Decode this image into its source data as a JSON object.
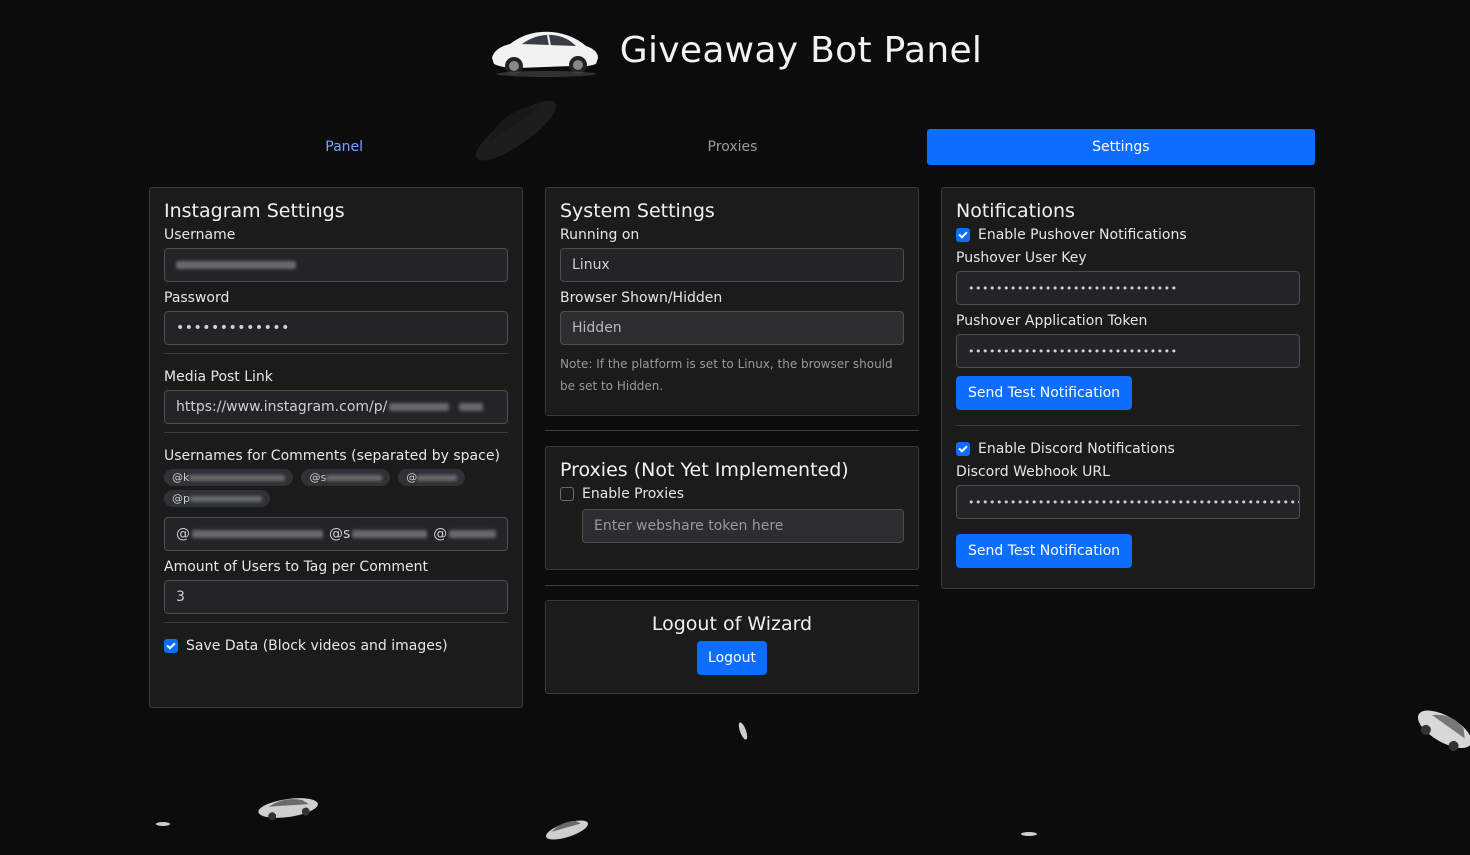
{
  "app": {
    "title": "Giveaway Bot Panel"
  },
  "tabs": [
    {
      "label": "Panel",
      "state": "link"
    },
    {
      "label": "Proxies",
      "state": "inactive"
    },
    {
      "label": "Settings",
      "state": "active"
    }
  ],
  "instagram": {
    "heading": "Instagram Settings",
    "username_label": "Username",
    "password_label": "Password",
    "password_value": "•••••••••••••",
    "media_label": "Media Post Link",
    "media_value": "https://www.instagram.com/p/",
    "comments_label": "Usernames for Comments (separated by space)",
    "chips": [
      "@k",
      "@s",
      "@",
      "@p"
    ],
    "comments_field_prefixes": [
      "@",
      "@s",
      "@"
    ],
    "amount_label": "Amount of Users to Tag per Comment",
    "amount_value": "3",
    "save_data_label": "Save Data (Block videos and images)",
    "save_data_checked": true
  },
  "system": {
    "heading": "System Settings",
    "running_label": "Running on",
    "running_value": "Linux",
    "browser_label": "Browser Shown/Hidden",
    "browser_value": "Hidden",
    "note": "Note: If the platform is set to Linux, the browser should be set to Hidden."
  },
  "proxies": {
    "heading": "Proxies (Not Yet Implemented)",
    "enable_label": "Enable Proxies",
    "enable_checked": false,
    "token_placeholder": "Enter webshare token here"
  },
  "logout": {
    "heading": "Logout of Wizard",
    "button_label": "Logout"
  },
  "notifications": {
    "heading": "Notifications",
    "pushover_enable_label": "Enable Pushover Notifications",
    "pushover_enabled": true,
    "user_key_label": "Pushover User Key",
    "user_key_value": "••••••••••••••••••••••••••••••",
    "app_token_label": "Pushover Application Token",
    "app_token_value": "••••••••••••••••••••••••••••••",
    "test_button_label": "Send Test Notification",
    "discord_enable_label": "Enable Discord Notifications",
    "discord_enabled": true,
    "webhook_label": "Discord Webhook URL",
    "webhook_value": "•••••••••••••••••••••••••••••••••••••••••••••••••••••••••••••••••••••",
    "discord_test_button_label": "Send Test Notification"
  },
  "colors": {
    "accent": "#0d6efd",
    "background": "#0c0c0c",
    "card": "#1b1b1b",
    "link": "#6ea8fe"
  }
}
